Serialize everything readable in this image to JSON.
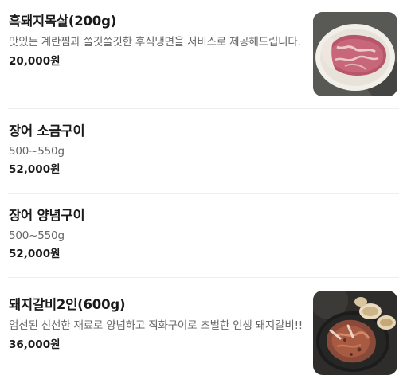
{
  "menu": {
    "items": [
      {
        "name": "흑돼지목살(200g)",
        "description": "맛있는 계란찜과 쫄깃쫄깃한 후식냉면을 서비스로 제공해드립니다.",
        "price": "20,000원",
        "image": "grilled-pork-neck-photo"
      },
      {
        "name": "장어 소금구이",
        "description": "500~550g",
        "price": "52,000원"
      },
      {
        "name": "장어 양념구이",
        "description": "500~550g",
        "price": "52,000원"
      },
      {
        "name": "돼지갈비2인(600g)",
        "description": "엄선된 신선한 재료로 양념하고 직화구이로 초벌한 인생 돼지갈비!!",
        "price": "36,000원",
        "image": "marinated-pork-ribs-photo"
      }
    ]
  }
}
